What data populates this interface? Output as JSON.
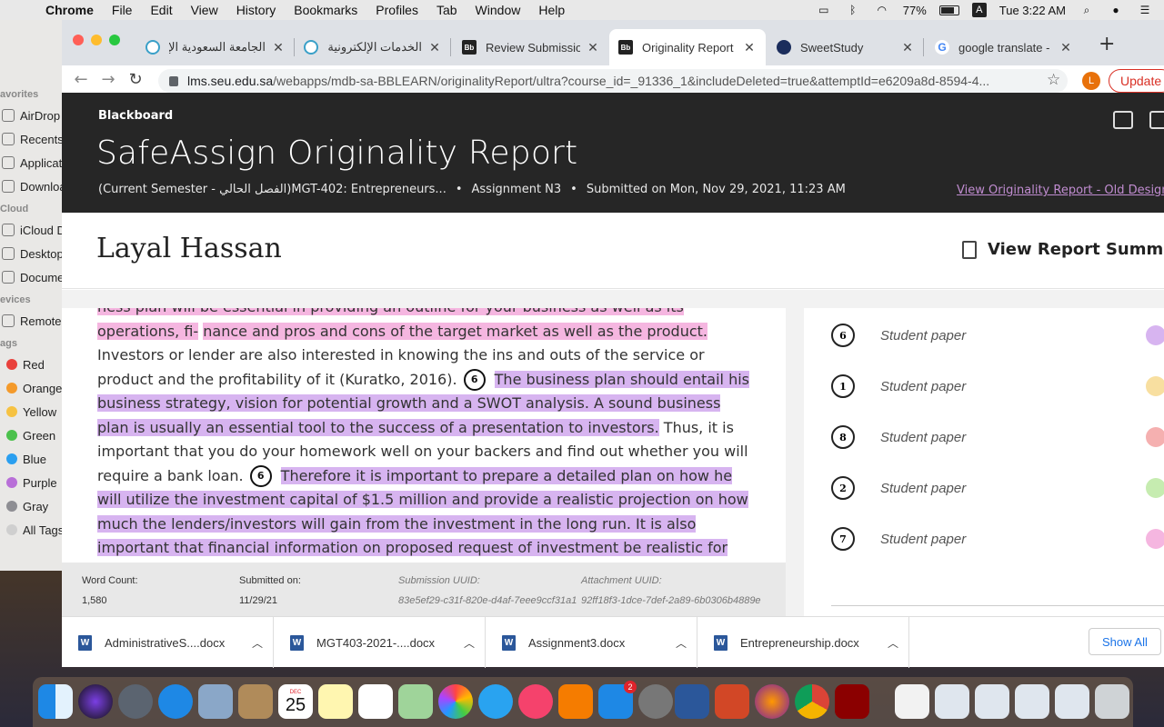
{
  "menubar": {
    "app": "Chrome",
    "items": [
      "File",
      "Edit",
      "View",
      "History",
      "Bookmarks",
      "Profiles",
      "Tab",
      "Window",
      "Help"
    ],
    "battery": "77%",
    "input_source": "A",
    "clock": "Tue 3:22 AM"
  },
  "finder": {
    "favorites_header": "avorites",
    "favorites": [
      "AirDrop",
      "Recents",
      "Applications",
      "Downloads"
    ],
    "icloud_header": "Cloud",
    "icloud": [
      "iCloud Drive",
      "Desktop",
      "Documents"
    ],
    "devices_header": "evices",
    "devices": [
      "Remote Disc"
    ],
    "tags_header": "ags",
    "tags": [
      {
        "label": "Red",
        "color": "#e9413c"
      },
      {
        "label": "Orange",
        "color": "#f49a2b"
      },
      {
        "label": "Yellow",
        "color": "#f6c242"
      },
      {
        "label": "Green",
        "color": "#4bc14c"
      },
      {
        "label": "Blue",
        "color": "#2a9ff0"
      },
      {
        "label": "Purple",
        "color": "#b86fd8"
      },
      {
        "label": "Gray",
        "color": "#8e8e93"
      },
      {
        "label": "All Tags...",
        "color": "#cfcfcf"
      }
    ]
  },
  "tabs": [
    {
      "title": "الجامعة السعودية الإلكترونية",
      "icon": "seu-globe-icon",
      "active": false
    },
    {
      "title": "الخدمات الإلكترونية - الجامعة",
      "icon": "seu-globe-icon",
      "active": false
    },
    {
      "title": "Review Submission",
      "icon": "blackboard-icon",
      "active": false
    },
    {
      "title": "Originality Report",
      "icon": "blackboard-icon",
      "active": true
    },
    {
      "title": "SweetStudy",
      "icon": "sweetstudy-icon",
      "active": false
    },
    {
      "title": "google translate - G",
      "icon": "google-icon",
      "active": false
    }
  ],
  "address": {
    "host": "lms.seu.edu.sa",
    "path": "/webapps/mdb-sa-BBLEARN/originalityReport/ultra?course_id=_91336_1&includeDeleted=true&attemptId=e6209a8d-8594-4...",
    "profile_initial": "L",
    "update_label": "Update"
  },
  "report": {
    "brand": "Blackboard",
    "title": "SafeAssign Originality Report",
    "course": "(Current Semester - الفصل الحالي)MGT-402: Entrepreneurs...",
    "assignment": "Assignment N3",
    "submitted": "Submitted on Mon, Nov 29, 2021, 11:23 AM",
    "old_design_link": "View Originality Report - Old Design",
    "student": "Layal Hassan",
    "summary_label": "View Report Summary"
  },
  "document": {
    "p1_pink_cut": "ness plan will be essential in providing an outline for your business as well as its operations, fi-",
    "p1_pink": "nance and pros and cons of the target market as well as the product.",
    "p1_plain": " Investors or lender are also interested in knowing the ins and outs of the service or product and the profitability of it (Kuratko, 2016).",
    "cite_a": "6",
    "p2_violet": "The business plan should entail his business strategy, vision for potential growth and a SWOT analysis. A sound business plan is usually an essential tool to the success of a presentation to investors.",
    "p2_plain": " Thus, it is important that you do your homework well on your back­ers and find out whether you will require a bank loan.",
    "cite_b": "6",
    "p3_violet": "Therefore it is important to prepare a detailed plan on how he will utilize the investment capital of $1.5 million and provide a realis­tic projection on how much the lenders/investors will gain from the investment in the long run. It is also important that financial information on proposed request of investment be realistic for the entity to be considered by the venture capitalists basing on their screening criteria (Kuratko,"
  },
  "footer": {
    "word_count_label": "Word Count:",
    "word_count": "1,580",
    "submitted_label": "Submitted on:",
    "submitted_value": "11/29/21",
    "submission_uuid_label": "Submission UUID:",
    "submission_uuid": "83e5ef29-c31f-820e-d4af-7eee9ccf31a1",
    "attachment_uuid_label": "Attachment UUID:",
    "attachment_uuid": "92ff18f3-1dce-7def-2a89-6b0306b4889e"
  },
  "sources": [
    {
      "num": "6",
      "label": "Student paper",
      "color": "#d7b4f0"
    },
    {
      "num": "1",
      "label": "Student paper",
      "color": "#f8dfa0"
    },
    {
      "num": "8",
      "label": "Student paper",
      "color": "#f5b0b0"
    },
    {
      "num": "2",
      "label": "Student paper",
      "color": "#c6ecb0"
    },
    {
      "num": "7",
      "label": "Student paper",
      "color": "#f5b6e0"
    }
  ],
  "downloads": {
    "items": [
      "AdministrativeS....docx",
      "MGT403-2021-....docx",
      "Assignment3.docx",
      "Entrepreneurship.docx"
    ],
    "file_icon_letter": "W",
    "show_all": "Show All"
  },
  "dock": {
    "calendar_month": "DEC",
    "calendar_day": "25",
    "appstore_badge": "2"
  }
}
